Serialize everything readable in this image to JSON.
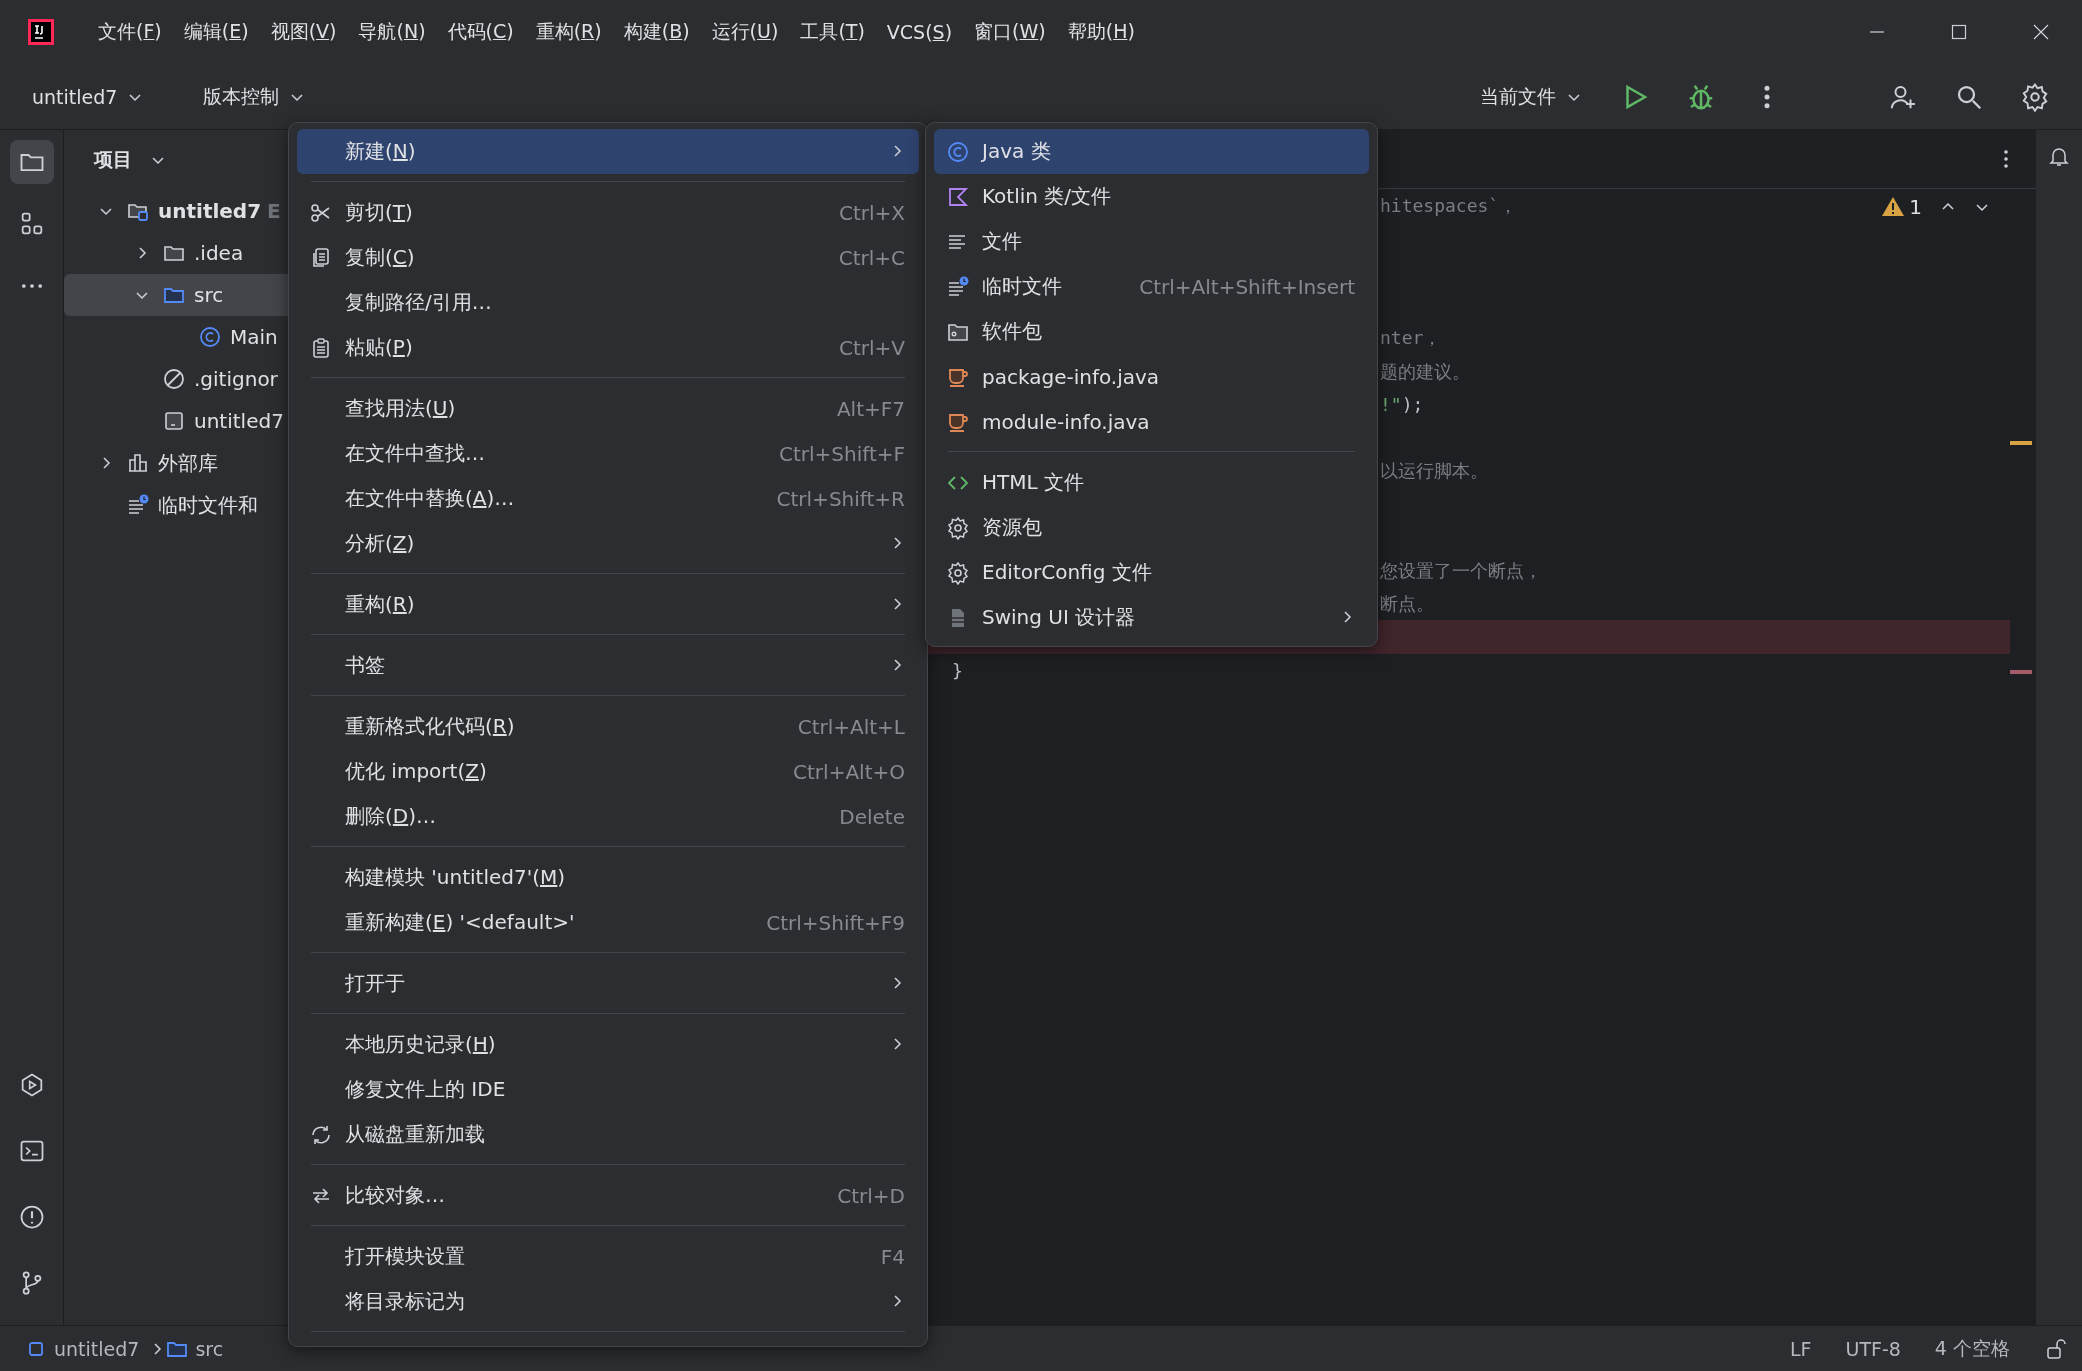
{
  "title_bar": {
    "menus": [
      {
        "text": "文件(",
        "key": "F",
        "end": ")"
      },
      {
        "text": "编辑(",
        "key": "E",
        "end": ")"
      },
      {
        "text": "视图(",
        "key": "V",
        "end": ")"
      },
      {
        "text": "导航(",
        "key": "N",
        "end": ")"
      },
      {
        "text": "代码(",
        "key": "C",
        "end": ")"
      },
      {
        "text": "重构(",
        "key": "R",
        "end": ")"
      },
      {
        "text": "构建(",
        "key": "B",
        "end": ")"
      },
      {
        "text": "运行(",
        "key": "U",
        "end": ")"
      },
      {
        "text": "工具(",
        "key": "T",
        "end": ")"
      },
      {
        "text": "VCS(",
        "key": "S",
        "end": ")"
      },
      {
        "text": "窗口(",
        "key": "W",
        "end": ")"
      },
      {
        "text": "帮助(",
        "key": "H",
        "end": ")"
      }
    ]
  },
  "toolbar": {
    "project": "untitled7",
    "vcs": "版本控制",
    "run_config": "当前文件"
  },
  "project_panel": {
    "title": "项目",
    "tree": [
      {
        "label": "untitled7",
        "hint": "E",
        "kind": "project",
        "expanded": true,
        "selected": false,
        "children": [
          {
            "label": ".idea",
            "kind": "folder",
            "expanded": false,
            "selected": false
          },
          {
            "label": "src",
            "kind": "source",
            "expanded": true,
            "selected": true,
            "children": [
              {
                "label": "Main",
                "kind": "class",
                "selected": false
              }
            ]
          },
          {
            "label": ".gitignor",
            "kind": "ignore",
            "selected": false
          },
          {
            "label": "untitled7",
            "kind": "module",
            "selected": false
          }
        ]
      },
      {
        "label": "外部库",
        "kind": "library",
        "expanded": false,
        "selected": false
      },
      {
        "label": "临时文件和",
        "kind": "scratch",
        "selected": false
      }
    ]
  },
  "editor": {
    "warnings": "1",
    "lines": [
      {
        "kind": "tail",
        "parts": [
          {
            "text": "hitespaces`，",
            "kind": "comment"
          }
        ]
      },
      {
        "kind": "blank"
      },
      {
        "kind": "blank"
      },
      {
        "kind": "blank"
      },
      {
        "kind": "tail",
        "parts": [
          {
            "text": "nter，",
            "kind": "comment"
          }
        ]
      },
      {
        "kind": "tail",
        "parts": [
          {
            "text": "题的建议。",
            "kind": "comment"
          }
        ]
      },
      {
        "kind": "tail",
        "parts": [
          {
            "text": "!\"",
            "kind": "string"
          },
          {
            "text": ");",
            "kind": "plain"
          }
        ]
      },
      {
        "kind": "blank"
      },
      {
        "kind": "tail",
        "parts": [
          {
            "text": "以运行脚本。",
            "kind": "comment"
          }
        ]
      },
      {
        "kind": "blank"
      },
      {
        "kind": "blank"
      },
      {
        "kind": "tail",
        "parts": [
          {
            "text": "您设置了一个断点，",
            "kind": "comment"
          }
        ]
      },
      {
        "kind": "tail",
        "parts": [
          {
            "text": "断点。",
            "kind": "comment"
          }
        ]
      },
      {
        "kind": "breakpoint"
      },
      {
        "kind": "brace",
        "parts": [
          {
            "text": "}",
            "kind": "plain"
          }
        ]
      }
    ]
  },
  "context_menu": {
    "items": [
      {
        "kind": "plain",
        "text": "新建(",
        "key": "N",
        "end": ")",
        "submenu": true,
        "selected": true
      },
      {
        "kind": "separator"
      },
      {
        "kind": "scissors",
        "text": "剪切(",
        "key": "T",
        "end": ")",
        "shortcut": "Ctrl+X",
        "submenu": false,
        "selected": false
      },
      {
        "kind": "copy",
        "text": "复制(",
        "key": "C",
        "end": ")",
        "shortcut": "Ctrl+C",
        "submenu": false,
        "selected": false
      },
      {
        "kind": "plain",
        "text": "复制路径/引用…",
        "submenu": false,
        "selected": false
      },
      {
        "kind": "paste",
        "text": "粘贴(",
        "key": "P",
        "end": ")",
        "shortcut": "Ctrl+V",
        "submenu": false,
        "selected": false
      },
      {
        "kind": "separator"
      },
      {
        "kind": "plain",
        "text": "查找用法(",
        "key": "U",
        "end": ")",
        "shortcut": "Alt+F7",
        "submenu": false,
        "selected": false
      },
      {
        "kind": "plain",
        "text": "在文件中查找…",
        "shortcut": "Ctrl+Shift+F",
        "submenu": false,
        "selected": false
      },
      {
        "kind": "plain",
        "text": "在文件中替换(",
        "key": "A",
        "end": ")…",
        "shortcut": "Ctrl+Shift+R",
        "submenu": false,
        "selected": false
      },
      {
        "kind": "plain",
        "text": "分析(",
        "key": "Z",
        "end": ")",
        "submenu": true,
        "selected": false
      },
      {
        "kind": "separator"
      },
      {
        "kind": "plain",
        "text": "重构(",
        "key": "R",
        "end": ")",
        "submenu": true,
        "selected": false
      },
      {
        "kind": "separator"
      },
      {
        "kind": "plain",
        "text": "书签",
        "submenu": true,
        "selected": false
      },
      {
        "kind": "separator"
      },
      {
        "kind": "plain",
        "text": "重新格式化代码(",
        "key": "R",
        "end": ")",
        "shortcut": "Ctrl+Alt+L",
        "submenu": false,
        "selected": false
      },
      {
        "kind": "plain",
        "text": "优化 import(",
        "key": "Z",
        "end": ")",
        "shortcut": "Ctrl+Alt+O",
        "submenu": false,
        "selected": false
      },
      {
        "kind": "plain",
        "text": "删除(",
        "key": "D",
        "end": ")…",
        "shortcut": "Delete",
        "submenu": false,
        "selected": false
      },
      {
        "kind": "separator"
      },
      {
        "kind": "plain",
        "text": "构建模块 'untitled7'(",
        "key": "M",
        "end": ")",
        "submenu": false,
        "selected": false
      },
      {
        "kind": "plain",
        "text": "重新构建(",
        "key": "E",
        "end": ") '<default>'",
        "shortcut": "Ctrl+Shift+F9",
        "submenu": false,
        "selected": false
      },
      {
        "kind": "separator"
      },
      {
        "kind": "plain",
        "text": "打开于",
        "submenu": true,
        "selected": false
      },
      {
        "kind": "separator"
      },
      {
        "kind": "plain",
        "text": "本地历史记录(",
        "key": "H",
        "end": ")",
        "submenu": true,
        "selected": false
      },
      {
        "kind": "plain",
        "text": "修复文件上的 IDE",
        "submenu": false,
        "selected": false
      },
      {
        "kind": "reload",
        "text": "从磁盘重新加载",
        "submenu": false,
        "selected": false
      },
      {
        "kind": "separator"
      },
      {
        "kind": "compare",
        "text": "比较对象…",
        "shortcut": "Ctrl+D",
        "submenu": false,
        "selected": false
      },
      {
        "kind": "separator"
      },
      {
        "kind": "plain",
        "text": "打开模块设置",
        "shortcut": "F4",
        "submenu": false,
        "selected": false
      },
      {
        "kind": "plain",
        "text": "将目录标记为",
        "submenu": true,
        "selected": false
      },
      {
        "kind": "separator"
      }
    ]
  },
  "new_submenu": {
    "items": [
      {
        "kind": "class",
        "text": "Java 类",
        "submenu": false,
        "selected": true
      },
      {
        "kind": "kotlin",
        "text": "Kotlin 类/文件",
        "submenu": false,
        "selected": false
      },
      {
        "kind": "lines",
        "text": "文件",
        "submenu": false,
        "selected": false
      },
      {
        "kind": "scratch",
        "text": "临时文件",
        "shortcut": "Ctrl+Alt+Shift+Insert",
        "submenu": false,
        "selected": false
      },
      {
        "kind": "package",
        "text": "软件包",
        "submenu": false,
        "selected": false
      },
      {
        "kind": "cup",
        "text": "package-info.java",
        "submenu": false,
        "selected": false
      },
      {
        "kind": "cup",
        "text": "module-info.java",
        "submenu": false,
        "selected": false
      },
      {
        "kind": "separator"
      },
      {
        "kind": "html",
        "text": "HTML 文件",
        "submenu": false,
        "selected": false
      },
      {
        "kind": "gear",
        "text": "资源包",
        "submenu": false,
        "selected": false
      },
      {
        "kind": "gear",
        "text": "EditorConfig 文件",
        "submenu": false,
        "selected": false
      },
      {
        "kind": "form",
        "text": "Swing UI 设计器",
        "submenu": true,
        "selected": false
      }
    ]
  },
  "status_bar": {
    "breadcrumbs": [
      {
        "text": "untitled7",
        "kind": "module-square"
      },
      {
        "text": "src",
        "kind": "source"
      }
    ],
    "line_separator": "LF",
    "encoding": "UTF-8",
    "indent": "4 个空格"
  }
}
